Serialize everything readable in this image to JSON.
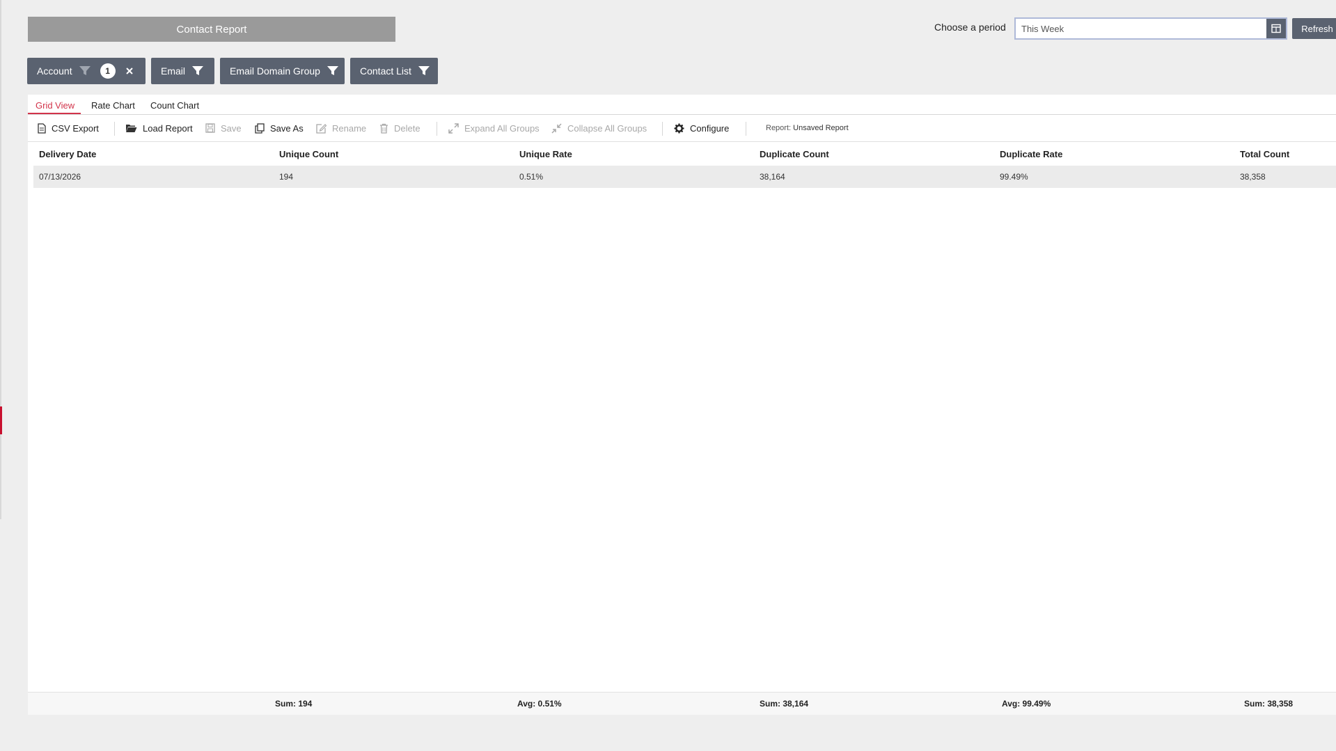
{
  "header": {
    "title": "Contact Report",
    "period_label": "Choose a period",
    "period_value": "This Week",
    "refresh_label": "Refresh"
  },
  "filters": [
    {
      "label": "Account",
      "count": "1"
    },
    {
      "label": "Email"
    },
    {
      "label": "Email Domain Group"
    },
    {
      "label": "Contact List"
    }
  ],
  "tabs": [
    {
      "label": "Grid View",
      "active": true
    },
    {
      "label": "Rate Chart"
    },
    {
      "label": "Count Chart"
    }
  ],
  "toolbar": {
    "csv_export": "CSV Export",
    "load_report": "Load Report",
    "save": "Save",
    "save_as": "Save As",
    "rename": "Rename",
    "delete": "Delete",
    "expand_all": "Expand All Groups",
    "collapse_all": "Collapse All Groups",
    "configure": "Configure",
    "report_prefix": "Report:",
    "report_name": "Unsaved Report"
  },
  "grid": {
    "columns": [
      "Delivery Date",
      "Unique Count",
      "Unique Rate",
      "Duplicate Count",
      "Duplicate Rate",
      "Total Count"
    ],
    "rows": [
      [
        "07/13/2026",
        "194",
        "0.51%",
        "38,164",
        "99.49%",
        "38,358"
      ]
    ],
    "footer": [
      "Sum: 194",
      "Avg: 0.51%",
      "Sum: 38,164",
      "Avg: 99.49%",
      "Sum: 38,358"
    ]
  },
  "colors": {
    "accent": "#d2334a",
    "button": "#5a6270",
    "title_bar": "#9a9a9a"
  }
}
